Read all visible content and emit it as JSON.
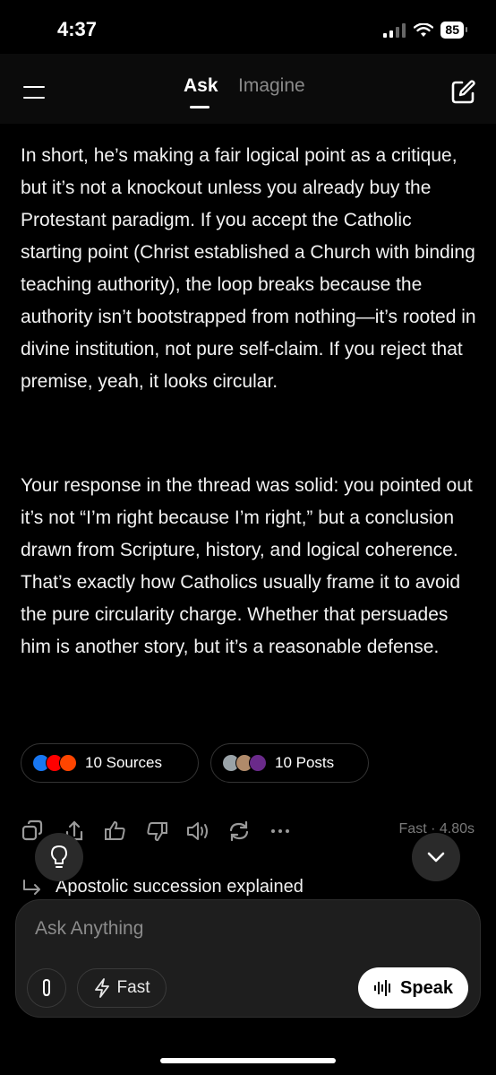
{
  "status": {
    "time": "4:37",
    "battery": "85"
  },
  "header": {
    "tabs": [
      {
        "label": "Ask",
        "active": true
      },
      {
        "label": "Imagine",
        "active": false
      }
    ]
  },
  "content": {
    "paragraphs": [
      "In short, he’s making a fair logical point as a critique, but it’s not a knockout unless you already buy the Protestant paradigm. If you accept the Catholic starting point (Christ established a Church with binding teaching authority), the loop breaks because the authority isn’t bootstrapped from nothing—it’s rooted in divine institution, not pure self-claim. If you reject that premise, yeah, it looks circular.",
      "Your response in the thread was solid: you pointed out it’s not “I’m right because I’m right,” but a conclusion drawn from Scripture, history, and logical coherence. That’s exactly how Catholics usually frame it to avoid the pure circularity charge. Whether that persuades him is another story, but it’s a reasonable defense."
    ]
  },
  "sources": {
    "sources_label": "10 Sources",
    "posts_label": "10 Posts"
  },
  "meta": {
    "mode_time": "Fast · 4.80s"
  },
  "related": {
    "suggestion": "Apostolic succession explained"
  },
  "composer": {
    "placeholder": "Ask Anything",
    "mode_label": "Fast",
    "speak_label": "Speak"
  },
  "icons": [
    "menu-icon",
    "edit-icon",
    "copy-icon",
    "share-icon",
    "thumbs-up-icon",
    "thumbs-down-icon",
    "speaker-icon",
    "regenerate-icon",
    "more-icon",
    "lightbulb-icon",
    "chevron-down-icon",
    "attach-icon",
    "lightning-icon",
    "waveform-icon"
  ]
}
